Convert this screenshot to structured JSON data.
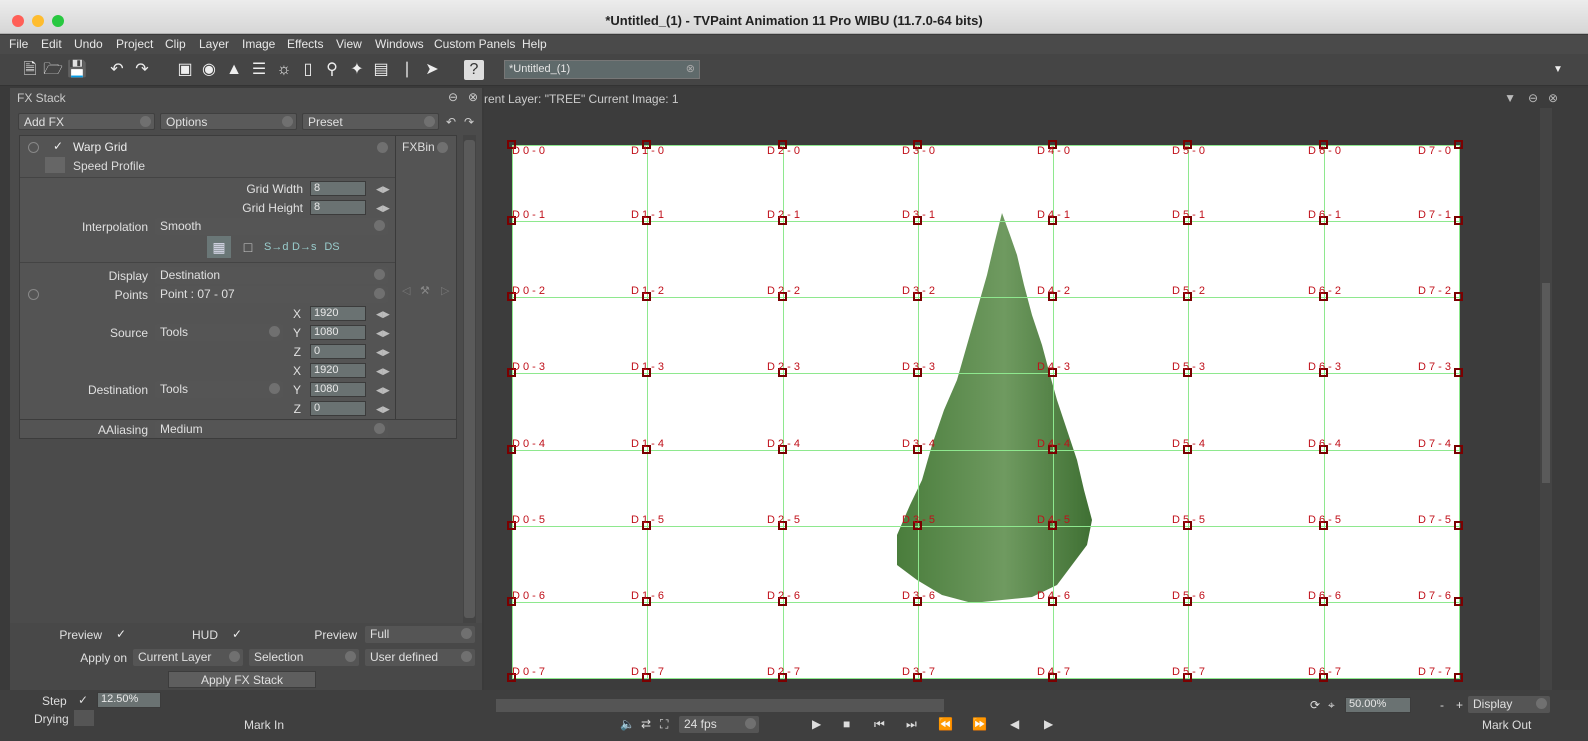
{
  "window": {
    "title": "*Untitled_(1) - TVPaint Animation 11 Pro WIBU (11.7.0-64 bits)"
  },
  "menu": [
    "File",
    "Edit",
    "Undo",
    "Project",
    "Clip",
    "Layer",
    "Image",
    "Effects",
    "View",
    "Windows",
    "Custom Panels",
    "Help"
  ],
  "document_tab": "*Untitled_(1)",
  "fx_stack": {
    "title": "FX Stack",
    "add_fx": "Add FX",
    "options": "Options",
    "preset": "Preset",
    "effect_name": "Warp Grid",
    "speed_profile": "Speed Profile",
    "fxbin": "FXBin",
    "grid_width_label": "Grid Width",
    "grid_width": "8",
    "grid_height_label": "Grid Height",
    "grid_height": "8",
    "interpolation_label": "Interpolation",
    "interpolation": "Smooth",
    "display_label": "Display",
    "display": "Destination",
    "points_label": "Points",
    "points": "Point : 07 - 07",
    "source_label": "Source",
    "source": "Tools",
    "source_x": "1920",
    "source_y": "1080",
    "source_z": "0",
    "destination_label": "Destination",
    "destination": "Tools",
    "dest_x": "1920",
    "dest_y": "1080",
    "dest_z": "0",
    "x_label": "X",
    "y_label": "Y",
    "z_label": "Z",
    "aaliasing_label": "AAliasing",
    "aaliasing": "Medium",
    "preview_label": "Preview",
    "hud_label": "HUD",
    "preview2_label": "Preview",
    "preview2": "Full",
    "apply_on_label": "Apply on",
    "apply_on": "Current Layer",
    "selection": "Selection",
    "user_defined": "User defined",
    "apply_button": "Apply FX Stack"
  },
  "canvas": {
    "header": "rent Layer: \"TREE\"  Current Image: 1",
    "grid_cols": 8,
    "grid_rows": 8
  },
  "bottom": {
    "step_label": "Step",
    "step_value": "12.50%",
    "drying_label": "Drying",
    "mark_in": "Mark In",
    "fps": "24 fps",
    "zoom": "50.00%",
    "display": "Display",
    "mark_out": "Mark Out"
  },
  "colors": {
    "grid_line": "#8ee88e",
    "point_label": "#c0101a",
    "tree": "#5a8f4a"
  }
}
